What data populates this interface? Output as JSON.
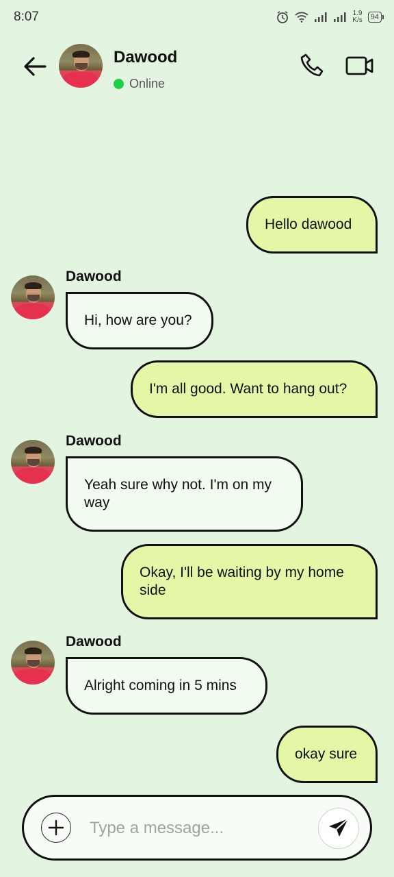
{
  "status_bar": {
    "time": "8:07",
    "icons": [
      "alarm-icon",
      "wifi-icon",
      "signal-icon",
      "signal-icon"
    ],
    "network_speed_value": "1.9",
    "network_speed_unit": "K/s",
    "battery": "94"
  },
  "header": {
    "back_icon": "arrow-left-icon",
    "contact_name": "Dawood",
    "status": "Online",
    "status_color": "#1fcf45",
    "call_icon": "phone-icon",
    "video_icon": "video-camera-icon"
  },
  "messages": [
    {
      "direction": "out",
      "text": "Hello dawood"
    },
    {
      "direction": "in",
      "sender": "Dawood",
      "text": "Hi, how are you?"
    },
    {
      "direction": "out",
      "text": "I'm all good. Want to hang out?"
    },
    {
      "direction": "in",
      "sender": "Dawood",
      "text": "Yeah sure why not. I'm on my way"
    },
    {
      "direction": "out",
      "text": "Okay, I'll be waiting by my home side"
    },
    {
      "direction": "in",
      "sender": "Dawood",
      "text": "Alright coming in 5 mins"
    },
    {
      "direction": "out",
      "text": "okay sure"
    }
  ],
  "composer": {
    "attach_icon": "plus-icon",
    "placeholder": "Type a message...",
    "value": "",
    "send_icon": "send-icon"
  },
  "colors": {
    "background": "#e3f4e1",
    "outgoing_bubble": "#e4f7a6",
    "incoming_bubble": "#f2fbf0",
    "border": "#111111"
  }
}
